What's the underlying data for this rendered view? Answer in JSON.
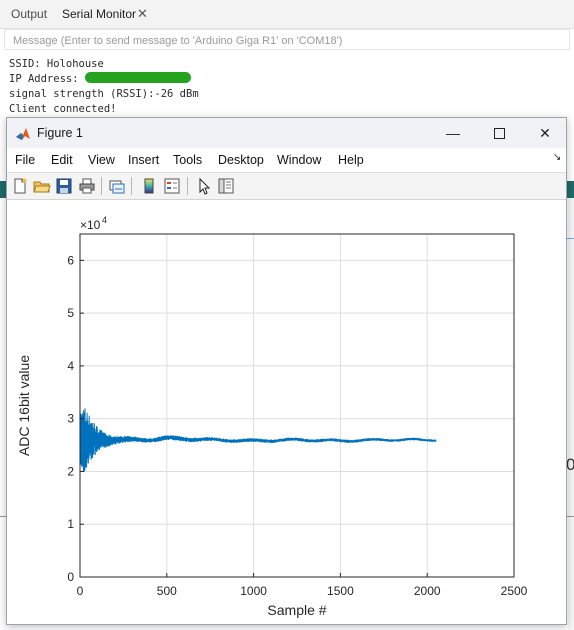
{
  "serial_monitor": {
    "tabs": [
      "Output",
      "Serial Monitor"
    ],
    "close_glyph": "✕",
    "message_placeholder": "Message (Enter to send message to 'Arduino Giga R1' on 'COM18')",
    "lines": [
      "SSID: Holohouse",
      "IP Address:",
      "signal strength (RSSI):-26 dBm",
      "Client connected!"
    ],
    "redaction_color": "#24a41e",
    "background_glyph": "0"
  },
  "figure_window": {
    "title": "Figure 1",
    "icon": "matlab-logo-icon",
    "controls": {
      "minimize": "—",
      "close": "✕"
    },
    "menu": [
      "File",
      "Edit",
      "View",
      "Insert",
      "Tools",
      "Desktop",
      "Window",
      "Help"
    ],
    "dock_glyph": "↘",
    "toolbar": [
      "new-figure-icon",
      "open-file-icon",
      "save-icon",
      "print-icon",
      "link-plot-icon",
      "insert-colorbar-icon",
      "insert-legend-icon",
      "edit-plot-cursor-icon",
      "property-inspector-icon"
    ]
  },
  "chart_data": {
    "type": "line",
    "title": "",
    "xlabel": "Sample #",
    "ylabel": "ADC 16bit value",
    "y_exponent_label": "×10",
    "y_exponent": "4",
    "xlim": [
      0,
      2500
    ],
    "ylim": [
      0,
      65000
    ],
    "xticks": [
      "0",
      "500",
      "1000",
      "1500",
      "2000",
      "2500"
    ],
    "yticks": [
      "0",
      "1",
      "2",
      "3",
      "4",
      "5",
      "6"
    ],
    "grid": true,
    "line_color": "#0072bd",
    "series": [
      {
        "x": [
          0,
          25,
          50,
          100,
          150,
          200,
          300,
          400,
          500,
          750,
          1000,
          1250,
          1500,
          1750,
          2000,
          2050
        ],
        "center": [
          26000,
          26000,
          26000,
          26000,
          26000,
          26000,
          26000,
          26000,
          26300,
          26000,
          25800,
          26000,
          25800,
          26000,
          26000,
          26000
        ],
        "spread": [
          5500,
          6500,
          4800,
          2400,
          1300,
          800,
          500,
          400,
          500,
          350,
          350,
          300,
          300,
          250,
          250,
          250
        ]
      }
    ]
  }
}
